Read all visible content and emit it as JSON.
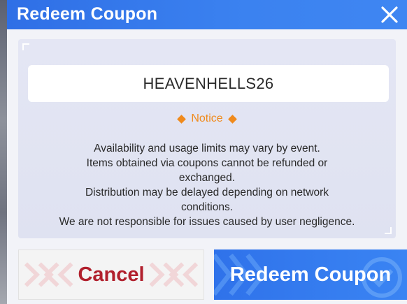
{
  "dialog": {
    "title": "Redeem Coupon",
    "close_icon": "close-icon"
  },
  "coupon": {
    "code": "HEAVENHELLS26"
  },
  "notice": {
    "heading": "Notice",
    "lines": [
      "Availability and usage limits may vary by event.",
      "Items obtained via coupons cannot be refunded or",
      "exchanged.",
      "Distribution may be delayed depending on network",
      "conditions.",
      "We are not responsible for issues caused by user negligence."
    ]
  },
  "buttons": {
    "cancel_label": "Cancel",
    "redeem_label": "Redeem Coupon"
  },
  "colors": {
    "title_bar": "#3b82f0",
    "notice_accent": "#f08a1c",
    "cancel_text": "#b1202d",
    "redeem_bg": "#3a84f3"
  }
}
